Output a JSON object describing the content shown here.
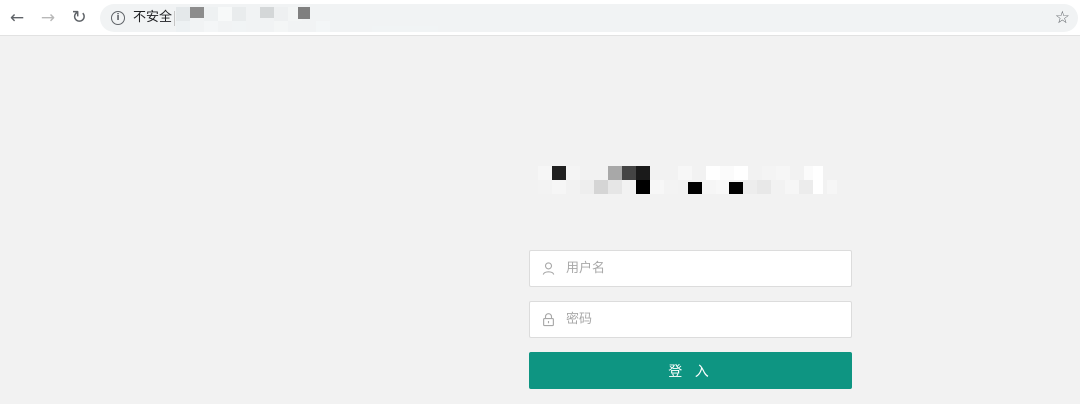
{
  "browser": {
    "back_icon": "arrow-left-icon",
    "forward_icon": "arrow-right-icon",
    "reload_icon": "reload-icon",
    "security_icon": "info-circle-icon",
    "security_label": "不安全",
    "url_state": "pixelated",
    "bookmark_icon": "star-outline-icon"
  },
  "brand": {
    "title_state": "pixelated"
  },
  "login": {
    "username": {
      "icon": "user-icon",
      "placeholder": "用户名",
      "value": ""
    },
    "password": {
      "icon": "lock-icon",
      "placeholder": "密码",
      "value": ""
    },
    "submit_label": "登 入"
  },
  "colors": {
    "page_background": "#f2f2f2",
    "primary_button": "#0e9582",
    "button_text": "#ffffff",
    "placeholder_text": "#a8a8a8"
  }
}
